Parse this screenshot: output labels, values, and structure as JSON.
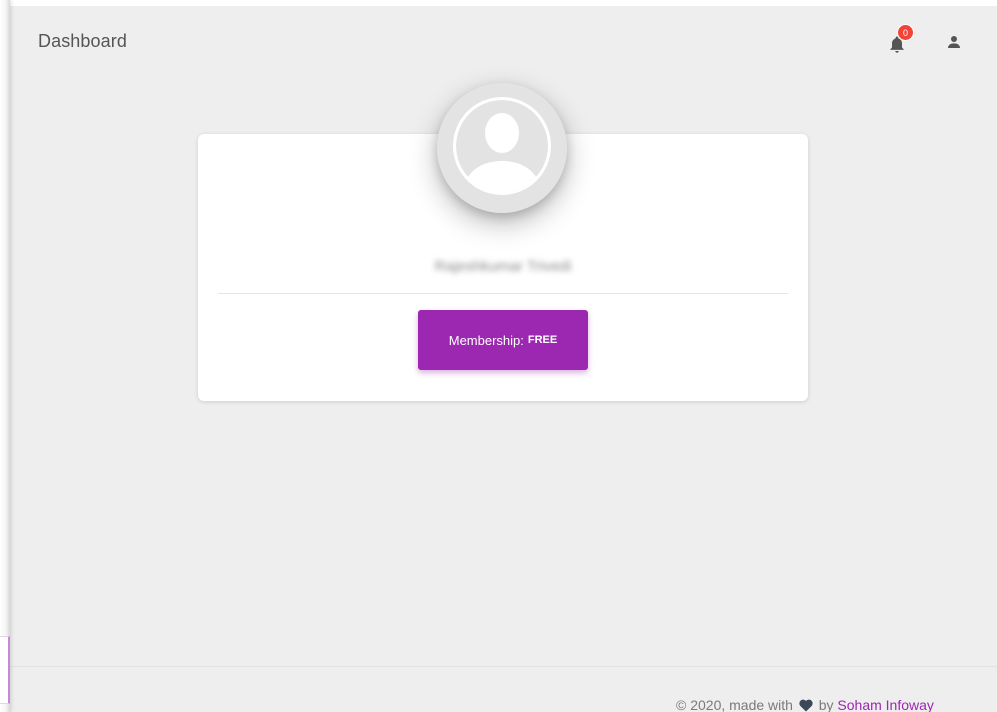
{
  "header": {
    "title": "Dashboard",
    "notifications_count": "0",
    "notifications_icon": "bell-icon",
    "user_icon": "person-icon"
  },
  "profile": {
    "avatar_icon": "user-avatar-placeholder-icon",
    "name": "Rajeshkumar Trivedi",
    "membership_label": "Membership:",
    "membership_value": "FREE"
  },
  "footer": {
    "prefix": "© 2020, made with",
    "heart_icon": "heart-icon",
    "by": "by",
    "company": "Soham Infoway"
  },
  "colors": {
    "accent": "#9c27b0",
    "badge": "#f44336",
    "background": "#eeeeee",
    "card": "#ffffff"
  }
}
